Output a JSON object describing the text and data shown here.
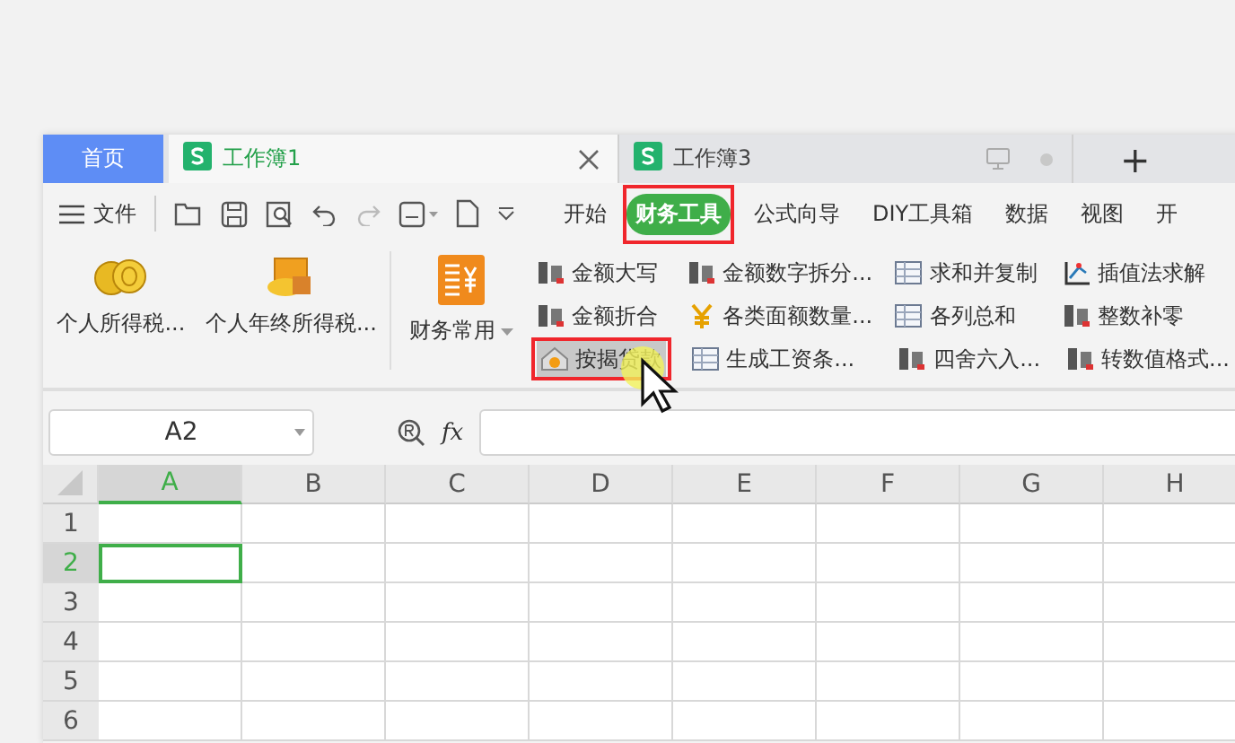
{
  "tabs": [
    {
      "label": "首页",
      "kind": "home",
      "selected": false
    },
    {
      "label": "工作簿1",
      "kind": "doc",
      "selected": true
    },
    {
      "label": "工作簿3",
      "kind": "doc",
      "selected": false
    }
  ],
  "new_tab": "+",
  "menu": {
    "file": "文件",
    "ribbon_tabs": [
      {
        "label": "开始",
        "selected": false,
        "annotated": false
      },
      {
        "label": "财务工具",
        "selected": true,
        "annotated": true
      },
      {
        "label": "公式向导",
        "selected": false,
        "annotated": false
      },
      {
        "label": "DIY工具箱",
        "selected": false,
        "annotated": false
      },
      {
        "label": "数据",
        "selected": false,
        "annotated": false
      },
      {
        "label": "视图",
        "selected": false,
        "annotated": false
      },
      {
        "label": "开",
        "selected": false,
        "annotated": false
      }
    ]
  },
  "ribbon": {
    "large": [
      {
        "label": "个人所得税...",
        "dropdown": false
      },
      {
        "label": "个人年终所得税...",
        "dropdown": false
      },
      {
        "label": "财务常用",
        "dropdown": true
      }
    ],
    "columns": [
      [
        {
          "label": "金额大写",
          "hovered": false,
          "annotated": false
        },
        {
          "label": "金额折合",
          "hovered": false,
          "annotated": false
        },
        {
          "label": "按揭贷款",
          "hovered": true,
          "annotated": true
        }
      ],
      [
        {
          "label": "金额数字拆分...",
          "hovered": false,
          "annotated": false
        },
        {
          "label": "各类面额数量...",
          "hovered": false,
          "annotated": false
        },
        {
          "label": "生成工资条...",
          "hovered": false,
          "annotated": false
        }
      ],
      [
        {
          "label": "求和并复制",
          "hovered": false,
          "annotated": false
        },
        {
          "label": "各列总和",
          "hovered": false,
          "annotated": false
        },
        {
          "label": "四舍六入...",
          "hovered": false,
          "annotated": false
        }
      ],
      [
        {
          "label": "插值法求解",
          "hovered": false,
          "annotated": false
        },
        {
          "label": "整数补零",
          "hovered": false,
          "annotated": false
        },
        {
          "label": "转数值格式...",
          "hovered": false,
          "annotated": false
        }
      ]
    ]
  },
  "formula_bar": {
    "name_box": "A2",
    "fx": "fx"
  },
  "grid": {
    "columns": [
      {
        "label": "A",
        "selected": true
      },
      {
        "label": "B",
        "selected": false
      },
      {
        "label": "C",
        "selected": false
      },
      {
        "label": "D",
        "selected": false
      },
      {
        "label": "E",
        "selected": false
      },
      {
        "label": "F",
        "selected": false
      },
      {
        "label": "G",
        "selected": false
      },
      {
        "label": "H",
        "selected": false
      }
    ],
    "rows": [
      {
        "label": "1",
        "selected": false
      },
      {
        "label": "2",
        "selected": true
      },
      {
        "label": "3",
        "selected": false
      },
      {
        "label": "4",
        "selected": false
      },
      {
        "label": "5",
        "selected": false
      },
      {
        "label": "6",
        "selected": false
      }
    ]
  }
}
